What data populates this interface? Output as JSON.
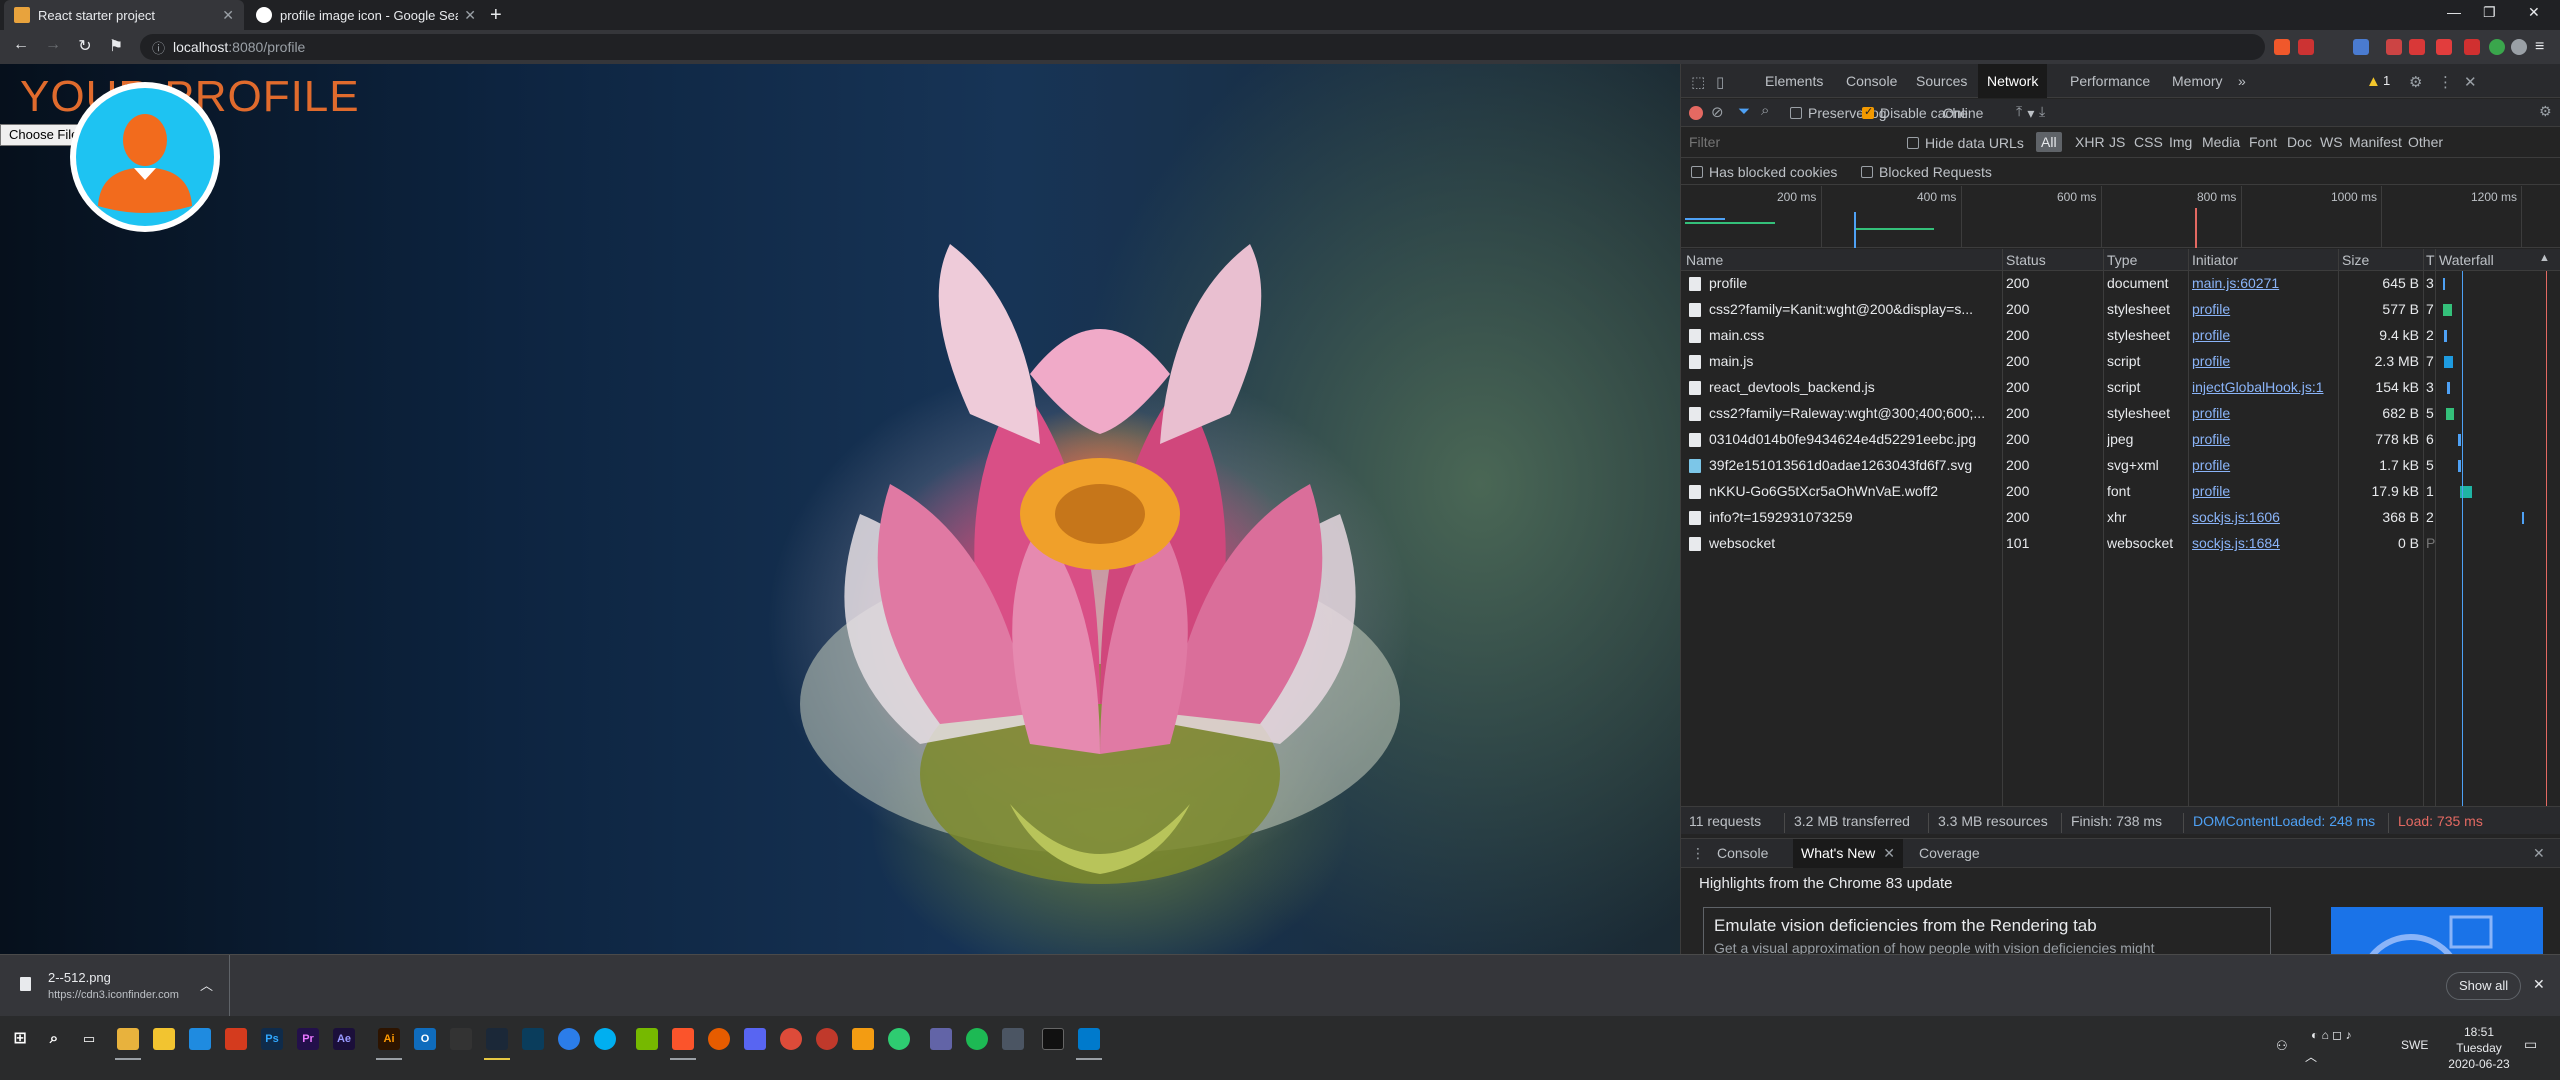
{
  "browser": {
    "tabs": [
      {
        "title": "React starter project",
        "active": true
      },
      {
        "title": "profile image icon - Google Search",
        "active": false
      }
    ],
    "url_host": "localhost",
    "url_path": ":8080/profile"
  },
  "page": {
    "title": "YOUR PROFILE",
    "choose_file_label": "Choose File"
  },
  "devtools": {
    "tabs": [
      "Elements",
      "Console",
      "Sources",
      "Network",
      "Performance",
      "Memory"
    ],
    "more_tabs": "»",
    "warning_count": "1",
    "controls": {
      "preserve_log": "Preserve log",
      "disable_cache": "Disable cache",
      "throttle": "Online"
    },
    "filter": {
      "placeholder": "Filter",
      "hide_data_urls": "Hide data URLs",
      "types": [
        "All",
        "XHR",
        "JS",
        "CSS",
        "Img",
        "Media",
        "Font",
        "Doc",
        "WS",
        "Manifest",
        "Other"
      ],
      "has_blocked_cookies": "Has blocked cookies",
      "blocked_requests": "Blocked Requests"
    },
    "overview_ticks": [
      "200 ms",
      "400 ms",
      "600 ms",
      "800 ms",
      "1000 ms",
      "1200 ms"
    ],
    "columns": {
      "name": "Name",
      "status": "Status",
      "type": "Type",
      "initiator": "Initiator",
      "size": "Size",
      "time": "T",
      "waterfall": "Waterfall"
    },
    "requests": [
      {
        "name": "profile",
        "status": "200",
        "type": "document",
        "initiator": "main.js:60271",
        "size": "645 B",
        "time": "3"
      },
      {
        "name": "css2?family=Kanit:wght@200&display=s...",
        "status": "200",
        "type": "stylesheet",
        "initiator": "profile",
        "size": "577 B",
        "time": "7"
      },
      {
        "name": "main.css",
        "status": "200",
        "type": "stylesheet",
        "initiator": "profile",
        "size": "9.4 kB",
        "time": "2"
      },
      {
        "name": "main.js",
        "status": "200",
        "type": "script",
        "initiator": "profile",
        "size": "2.3 MB",
        "time": "7"
      },
      {
        "name": "react_devtools_backend.js",
        "status": "200",
        "type": "script",
        "initiator": "injectGlobalHook.js:1",
        "size": "154 kB",
        "time": "3"
      },
      {
        "name": "css2?family=Raleway:wght@300;400;600;...",
        "status": "200",
        "type": "stylesheet",
        "initiator": "profile",
        "size": "682 B",
        "time": "5"
      },
      {
        "name": "03104d014b0fe9434624e4d52291eebc.jpg",
        "status": "200",
        "type": "jpeg",
        "initiator": "profile",
        "size": "778 kB",
        "time": "6"
      },
      {
        "name": "39f2e151013561d0adae1263043fd6f7.svg",
        "status": "200",
        "type": "svg+xml",
        "initiator": "profile",
        "size": "1.7 kB",
        "time": "5"
      },
      {
        "name": "nKKU-Go6G5tXcr5aOhWnVaE.woff2",
        "status": "200",
        "type": "font",
        "initiator": "profile",
        "size": "17.9 kB",
        "time": "1"
      },
      {
        "name": "info?t=1592931073259",
        "status": "200",
        "type": "xhr",
        "initiator": "sockjs.js:1606",
        "size": "368 B",
        "time": "2"
      },
      {
        "name": "websocket",
        "status": "101",
        "type": "websocket",
        "initiator": "sockjs.js:1684",
        "size": "0 B",
        "time": "P"
      }
    ],
    "summary": {
      "requests": "11 requests",
      "transferred": "3.2 MB transferred",
      "resources": "3.3 MB resources",
      "finish": "Finish: 738 ms",
      "dom_loaded": "DOMContentLoaded: 248 ms",
      "load": "Load: 735 ms"
    },
    "drawer": {
      "tabs": [
        "Console",
        "What's New",
        "Coverage"
      ],
      "heading": "Highlights from the Chrome 83 update",
      "card_title": "Emulate vision deficiencies from the Rendering tab",
      "card_desc": "Get a visual approximation of how people with vision deficiencies might experience your site."
    }
  },
  "download": {
    "filename": "2--512.png",
    "source": "https://cdn3.iconfinder.com",
    "show_all": "Show all"
  },
  "taskbar": {
    "time": "18:51",
    "day": "Tuesday",
    "date": "2020-06-23",
    "lang": "SWE"
  },
  "colors": {
    "accent_orange": "#e06b2d",
    "avatar_bg": "#1ec3f2",
    "link_blue": "#8ab4f8",
    "dom_loaded_blue": "#4ea1f5",
    "load_red": "#e46962"
  }
}
